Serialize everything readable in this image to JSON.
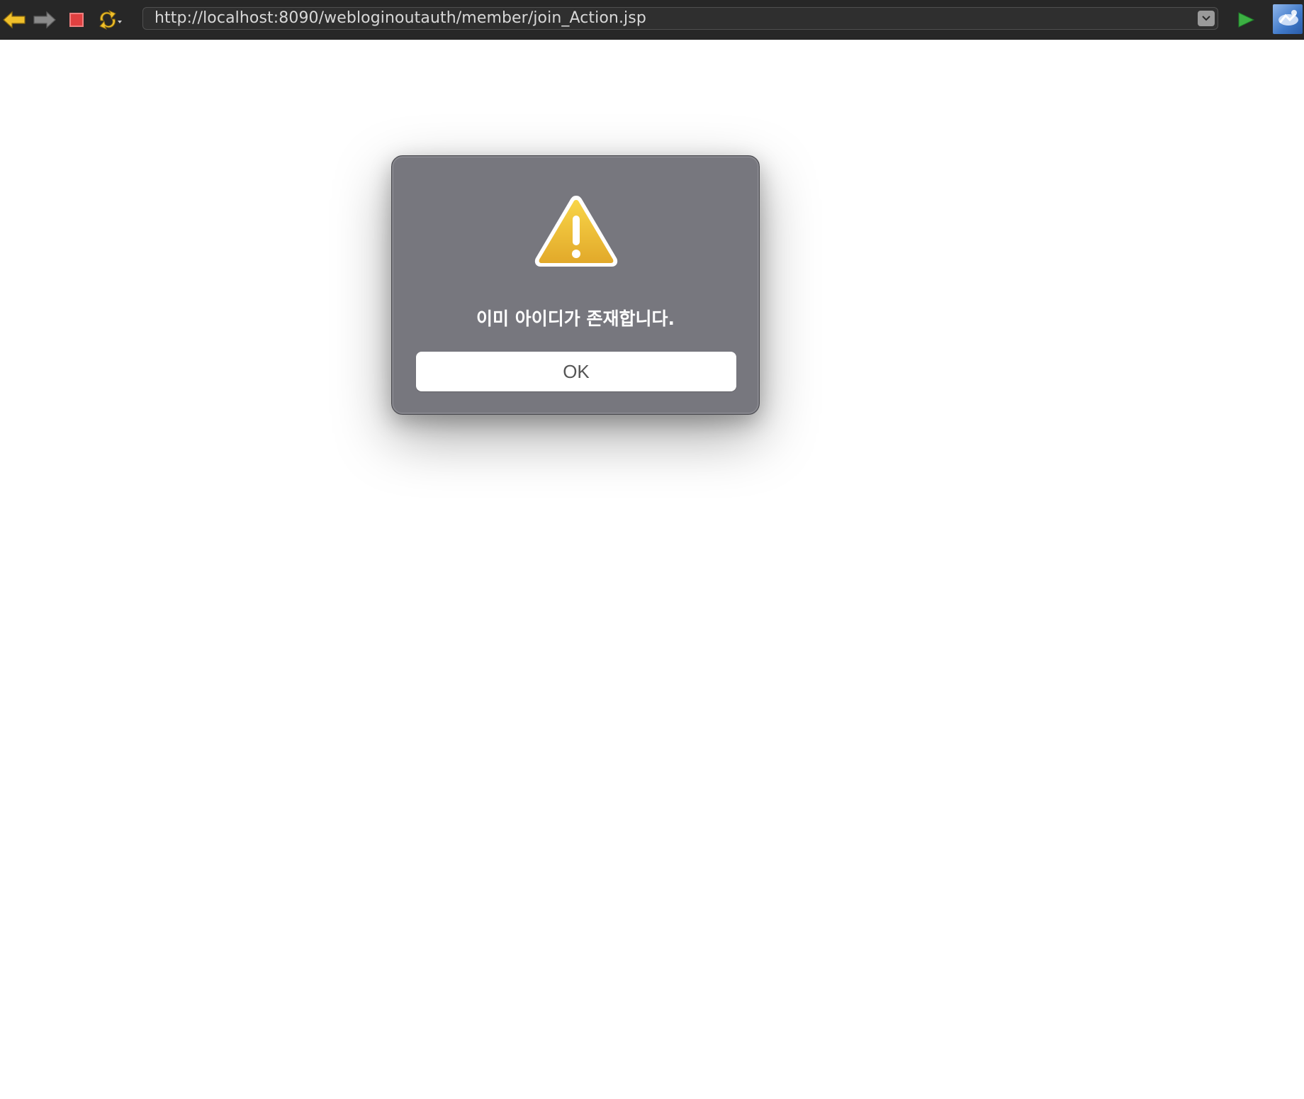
{
  "browser": {
    "url": "http://localhost:8090/webloginoutauth/member/join_Action.jsp",
    "buttons": {
      "back": "back-arrow-icon",
      "forward": "forward-arrow-icon",
      "stop": "stop-icon",
      "refresh": "refresh-icon",
      "go": "play-icon",
      "extension": "extension-icon"
    },
    "colors": {
      "toolbar_bg": "#272727",
      "back_arrow": "#f0c02a",
      "forward_arrow": "#8a8a8a",
      "stop": "#e04040",
      "go": "#3cb043"
    }
  },
  "alert": {
    "icon": "warning-triangle-icon",
    "message": "이미 아이디가 존재합니다.",
    "ok_label": "OK",
    "colors": {
      "background": "#77777e",
      "warning": "#f0c030",
      "button": "#ffffff"
    }
  }
}
